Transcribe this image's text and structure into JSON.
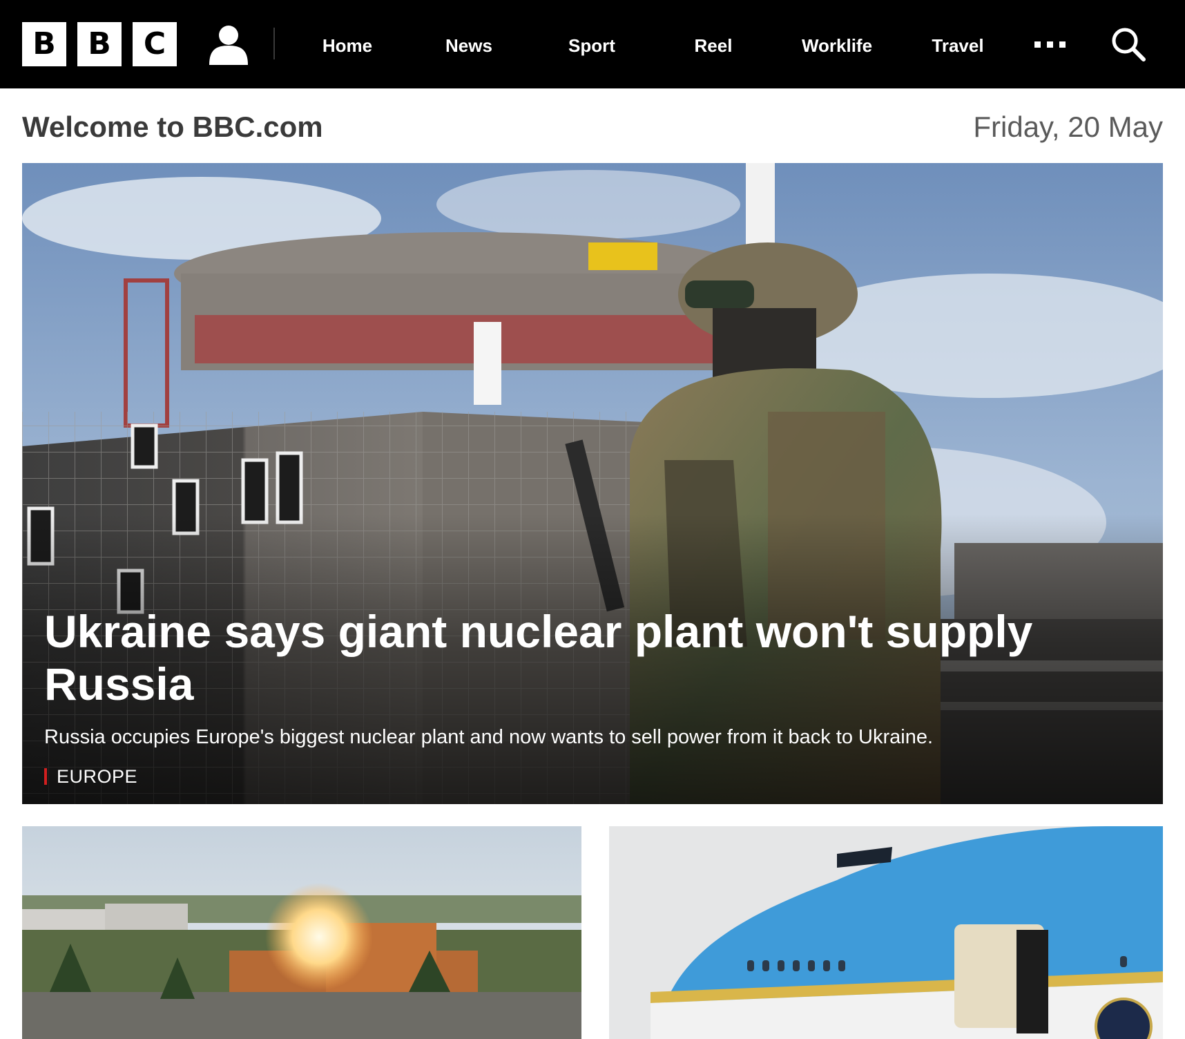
{
  "nav": {
    "logo_letters": [
      "B",
      "B",
      "C"
    ],
    "account_icon": "user-icon",
    "links": [
      {
        "label": "Home"
      },
      {
        "label": "News"
      },
      {
        "label": "Sport"
      },
      {
        "label": "Reel"
      },
      {
        "label": "Worklife"
      },
      {
        "label": "Travel"
      }
    ],
    "more_icon": "more-dots-icon",
    "search_icon": "search-icon"
  },
  "header": {
    "welcome": "Welcome to BBC.com",
    "date": "Friday, 20 May"
  },
  "hero": {
    "title": "Ukraine says giant nuclear plant won't supply Russia",
    "summary": "Russia occupies Europe's biggest nuclear plant and now wants to sell power from it back to Ukraine.",
    "tag": "EUROPE",
    "tag_color": "#d21f1f"
  },
  "cards": [
    {
      "image": "explosion-over-city-image"
    },
    {
      "image": "air-force-one-plane-image"
    }
  ],
  "colors": {
    "nav_bg": "#000000",
    "nav_text": "#ffffff",
    "welcome_text": "#3a3a3a",
    "date_text": "#5a5a5a"
  }
}
